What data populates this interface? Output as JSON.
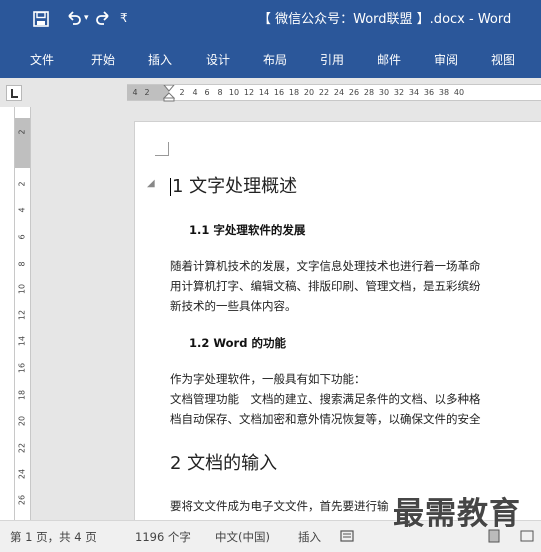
{
  "title_bar": {
    "doc_title": "【 微信公众号：Word联盟 】.docx - Word",
    "qat_icons": [
      "save-icon",
      "undo-icon",
      "redo-icon",
      "customize-icon"
    ],
    "undo_dropdown": "▾",
    "customize": "₹"
  },
  "ribbon": {
    "tabs": [
      {
        "label": "文件"
      },
      {
        "label": "开始"
      },
      {
        "label": "插入"
      },
      {
        "label": "设计"
      },
      {
        "label": "布局"
      },
      {
        "label": "引用"
      },
      {
        "label": "邮件"
      },
      {
        "label": "审阅"
      },
      {
        "label": "视图"
      }
    ]
  },
  "ruler": {
    "ticks": [
      "4",
      "2",
      "2",
      "4",
      "6",
      "8",
      "10",
      "12",
      "14",
      "16",
      "18",
      "20",
      "22",
      "24",
      "26",
      "28",
      "30",
      "32",
      "34",
      "36",
      "38",
      "40"
    ],
    "vertical_ticks": [
      "2",
      "2",
      "4",
      "6",
      "8",
      "10",
      "12",
      "14",
      "16",
      "18",
      "20",
      "22",
      "24",
      "26"
    ]
  },
  "document": {
    "heading1": "1 文字处理概述",
    "sections": [
      {
        "type": "h2",
        "text": "1.1 字处理软件的发展"
      },
      {
        "type": "p",
        "text": "随着计算机技术的发展，文字信息处理技术也进行着一场革命"
      },
      {
        "type": "p",
        "text": "用计算机打字、编辑文稿、排版印刷、管理文档，是五彩缤纷"
      },
      {
        "type": "p",
        "text": "新技术的一些具体内容。"
      },
      {
        "type": "h2",
        "text": "1.2 Word 的功能"
      },
      {
        "type": "p",
        "text": "作为字处理软件，一般具有如下功能："
      },
      {
        "type": "p",
        "text": "文档管理功能　文档的建立、搜索满足条件的文档、以多种格"
      },
      {
        "type": "p",
        "text": "档自动保存、文档加密和意外情况恢复等，以确保文件的安全"
      }
    ],
    "heading1_b": "2 文档的输入",
    "last_line": "要将文文件成为电子文文件，首先要进行输"
  },
  "status_bar": {
    "page_info": "第 1 页，共 4 页",
    "word_count": "1196 个字",
    "language": "中文(中国)",
    "mode": "插入"
  },
  "watermark": "最需教育",
  "colors": {
    "ribbon_blue": "#2b579a",
    "workspace_gray": "#e6e6e6",
    "ruler_margin": "#bfbfbf"
  }
}
